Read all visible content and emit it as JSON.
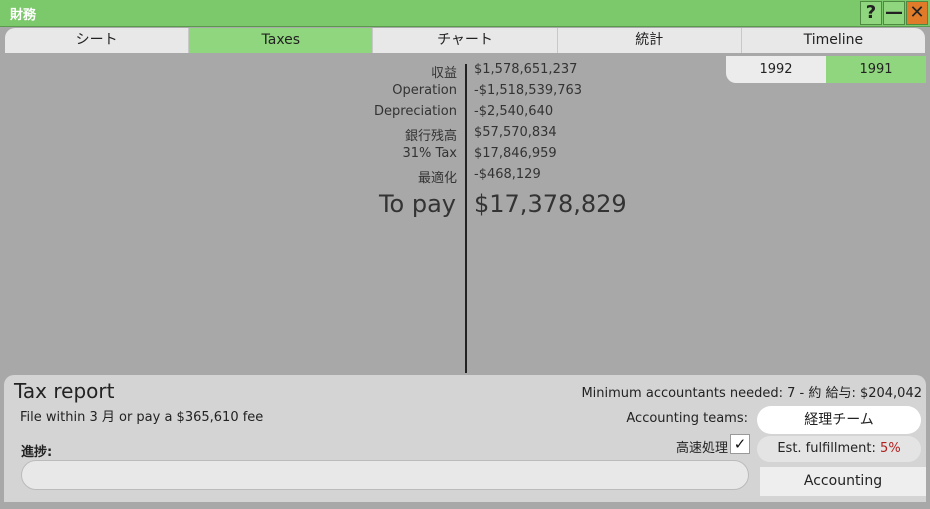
{
  "window": {
    "title": "財務",
    "help_label": "?",
    "minimize_label": "—",
    "close_label": "✕"
  },
  "tabs": [
    {
      "label": "シート",
      "active": false
    },
    {
      "label": "Taxes",
      "active": true
    },
    {
      "label": "チャート",
      "active": false
    },
    {
      "label": "統計",
      "active": false
    },
    {
      "label": "Timeline",
      "active": false
    }
  ],
  "years": [
    {
      "label": "1992",
      "active": false
    },
    {
      "label": "1991",
      "active": true
    }
  ],
  "tax_rows": [
    {
      "label": "収益",
      "value": "$1,578,651,237"
    },
    {
      "label": "Operation",
      "value": "-$1,518,539,763"
    },
    {
      "label": "Depreciation",
      "value": "-$2,540,640"
    },
    {
      "label": "銀行残高",
      "value": "$57,570,834"
    },
    {
      "label": "31% Tax",
      "value": "$17,846,959"
    },
    {
      "label": "最適化",
      "value": "-$468,129"
    }
  ],
  "to_pay": {
    "label": "To pay",
    "value": "$17,378,829"
  },
  "report": {
    "title": "Tax report",
    "subtitle": "File within 3 月 or pay a $365,610 fee",
    "progress_label": "進捗:",
    "progress": 0
  },
  "accounting": {
    "min_needed": "Minimum accountants needed: 7 - 約 給与: $204,042",
    "teams_label": "Accounting teams:",
    "team_button": "経理チーム",
    "fast_label": "高速処理",
    "fast_checked": true,
    "check_glyph": "✓",
    "est_label": "Est. fulfillment:",
    "est_value": "5%",
    "accounting_button": "Accounting"
  },
  "colors": {
    "accent": "#8fd67e",
    "title_bar": "#7bc96a",
    "close": "#e07b2a",
    "warning_text": "#b02020"
  }
}
